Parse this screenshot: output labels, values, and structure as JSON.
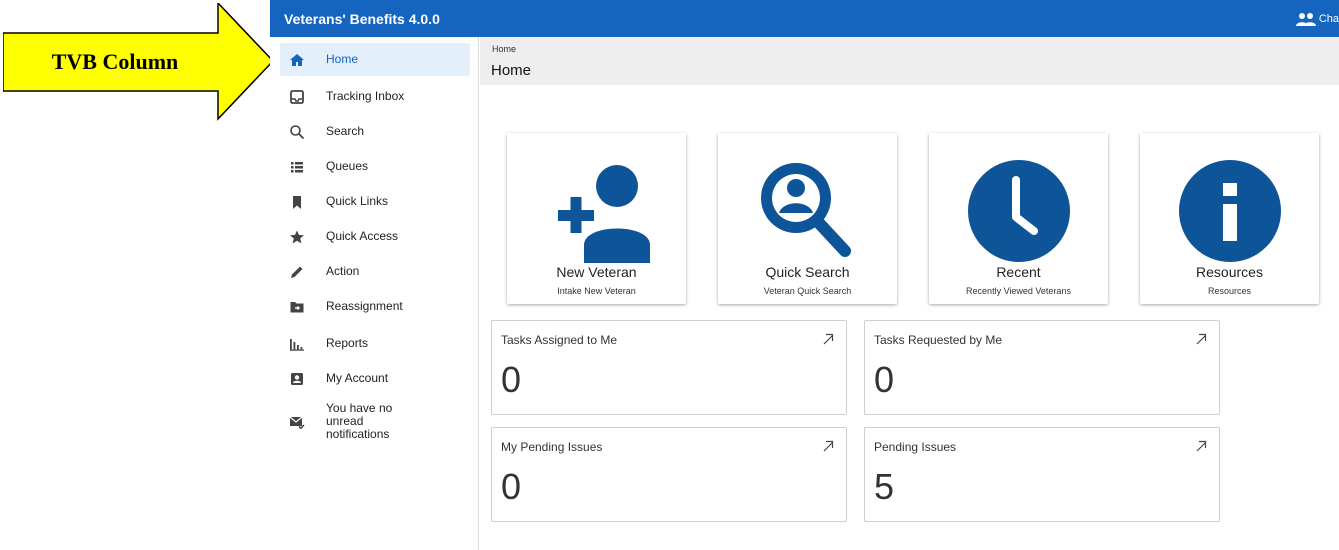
{
  "callout": {
    "label": "TVB Column",
    "color": "#ffff00"
  },
  "app": {
    "title": "Veterans' Benefits 4.0.0",
    "user_label": "Cha",
    "brand_color": "#1565c0"
  },
  "sidebar": {
    "items": [
      {
        "label": "Home",
        "icon": "home-icon",
        "active": true
      },
      {
        "label": "Tracking Inbox",
        "icon": "inbox-icon"
      },
      {
        "label": "Search",
        "icon": "search-icon"
      },
      {
        "label": "Queues",
        "icon": "list-icon"
      },
      {
        "label": "Quick Links",
        "icon": "bookmark-icon"
      },
      {
        "label": "Quick Access",
        "icon": "star-icon"
      },
      {
        "label": "Action",
        "icon": "pencil-icon"
      },
      {
        "label": "Reassignment",
        "icon": "folder-move-icon"
      },
      {
        "label": "Reports",
        "icon": "bar-chart-icon"
      },
      {
        "label": "My Account",
        "icon": "account-box-icon"
      },
      {
        "label": "You have no unread notifications",
        "icon": "mail-check-icon"
      }
    ]
  },
  "header": {
    "breadcrumb": "Home",
    "title": "Home"
  },
  "tiles": [
    {
      "title": "New Veteran",
      "subtitle": "Intake New Veteran",
      "icon": "add-person-icon"
    },
    {
      "title": "Quick Search",
      "subtitle": "Veteran Quick Search",
      "icon": "person-search-icon"
    },
    {
      "title": "Recent",
      "subtitle": "Recently Viewed Veterans",
      "icon": "clock-icon"
    },
    {
      "title": "Resources",
      "subtitle": "Resources",
      "icon": "info-icon"
    }
  ],
  "cards": [
    {
      "label": "Tasks Assigned to Me",
      "value": "0"
    },
    {
      "label": "Tasks Requested by Me",
      "value": "0"
    },
    {
      "label": "My Pending Issues",
      "value": "0"
    },
    {
      "label": "Pending Issues",
      "value": "5"
    }
  ]
}
